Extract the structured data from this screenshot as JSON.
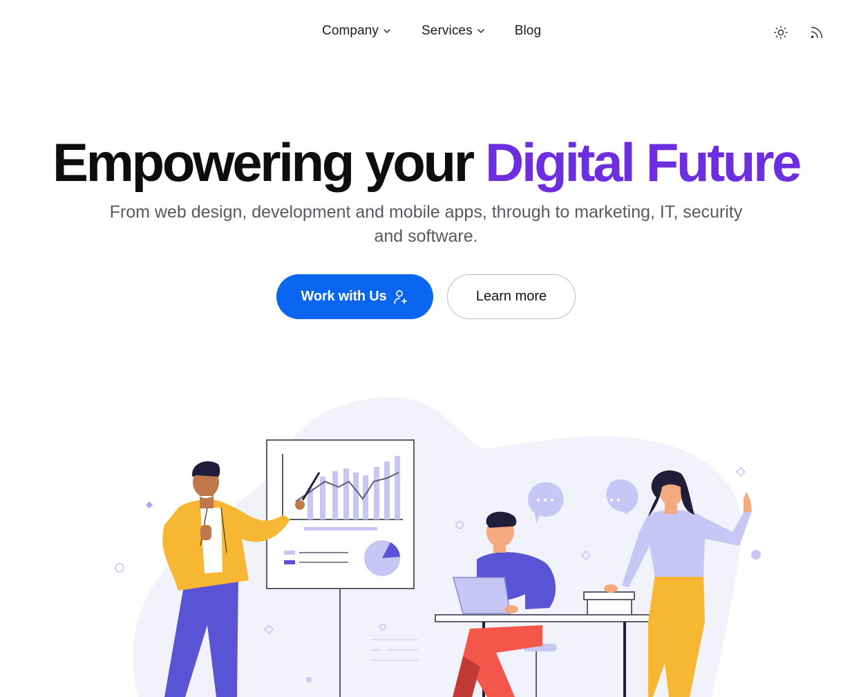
{
  "nav": {
    "items": [
      {
        "label": "Company",
        "has_dropdown": true
      },
      {
        "label": "Services",
        "has_dropdown": true
      },
      {
        "label": "Blog",
        "has_dropdown": false
      }
    ],
    "icons": [
      "sun-icon",
      "rss-icon"
    ]
  },
  "hero": {
    "headline_main": "Empowering your ",
    "headline_accent": "Digital Future",
    "subtitle": "From web design, development and mobile apps, through to marketing, IT, security and software.",
    "primary_cta": "Work with Us",
    "secondary_cta": "Learn more"
  },
  "colors": {
    "accent": "#6d2ee0",
    "primary_button": "#0a66f0",
    "illustration_lavender": "#c7c6f5",
    "illustration_indigo": "#5b53d6",
    "illustration_yellow": "#f7b733"
  }
}
